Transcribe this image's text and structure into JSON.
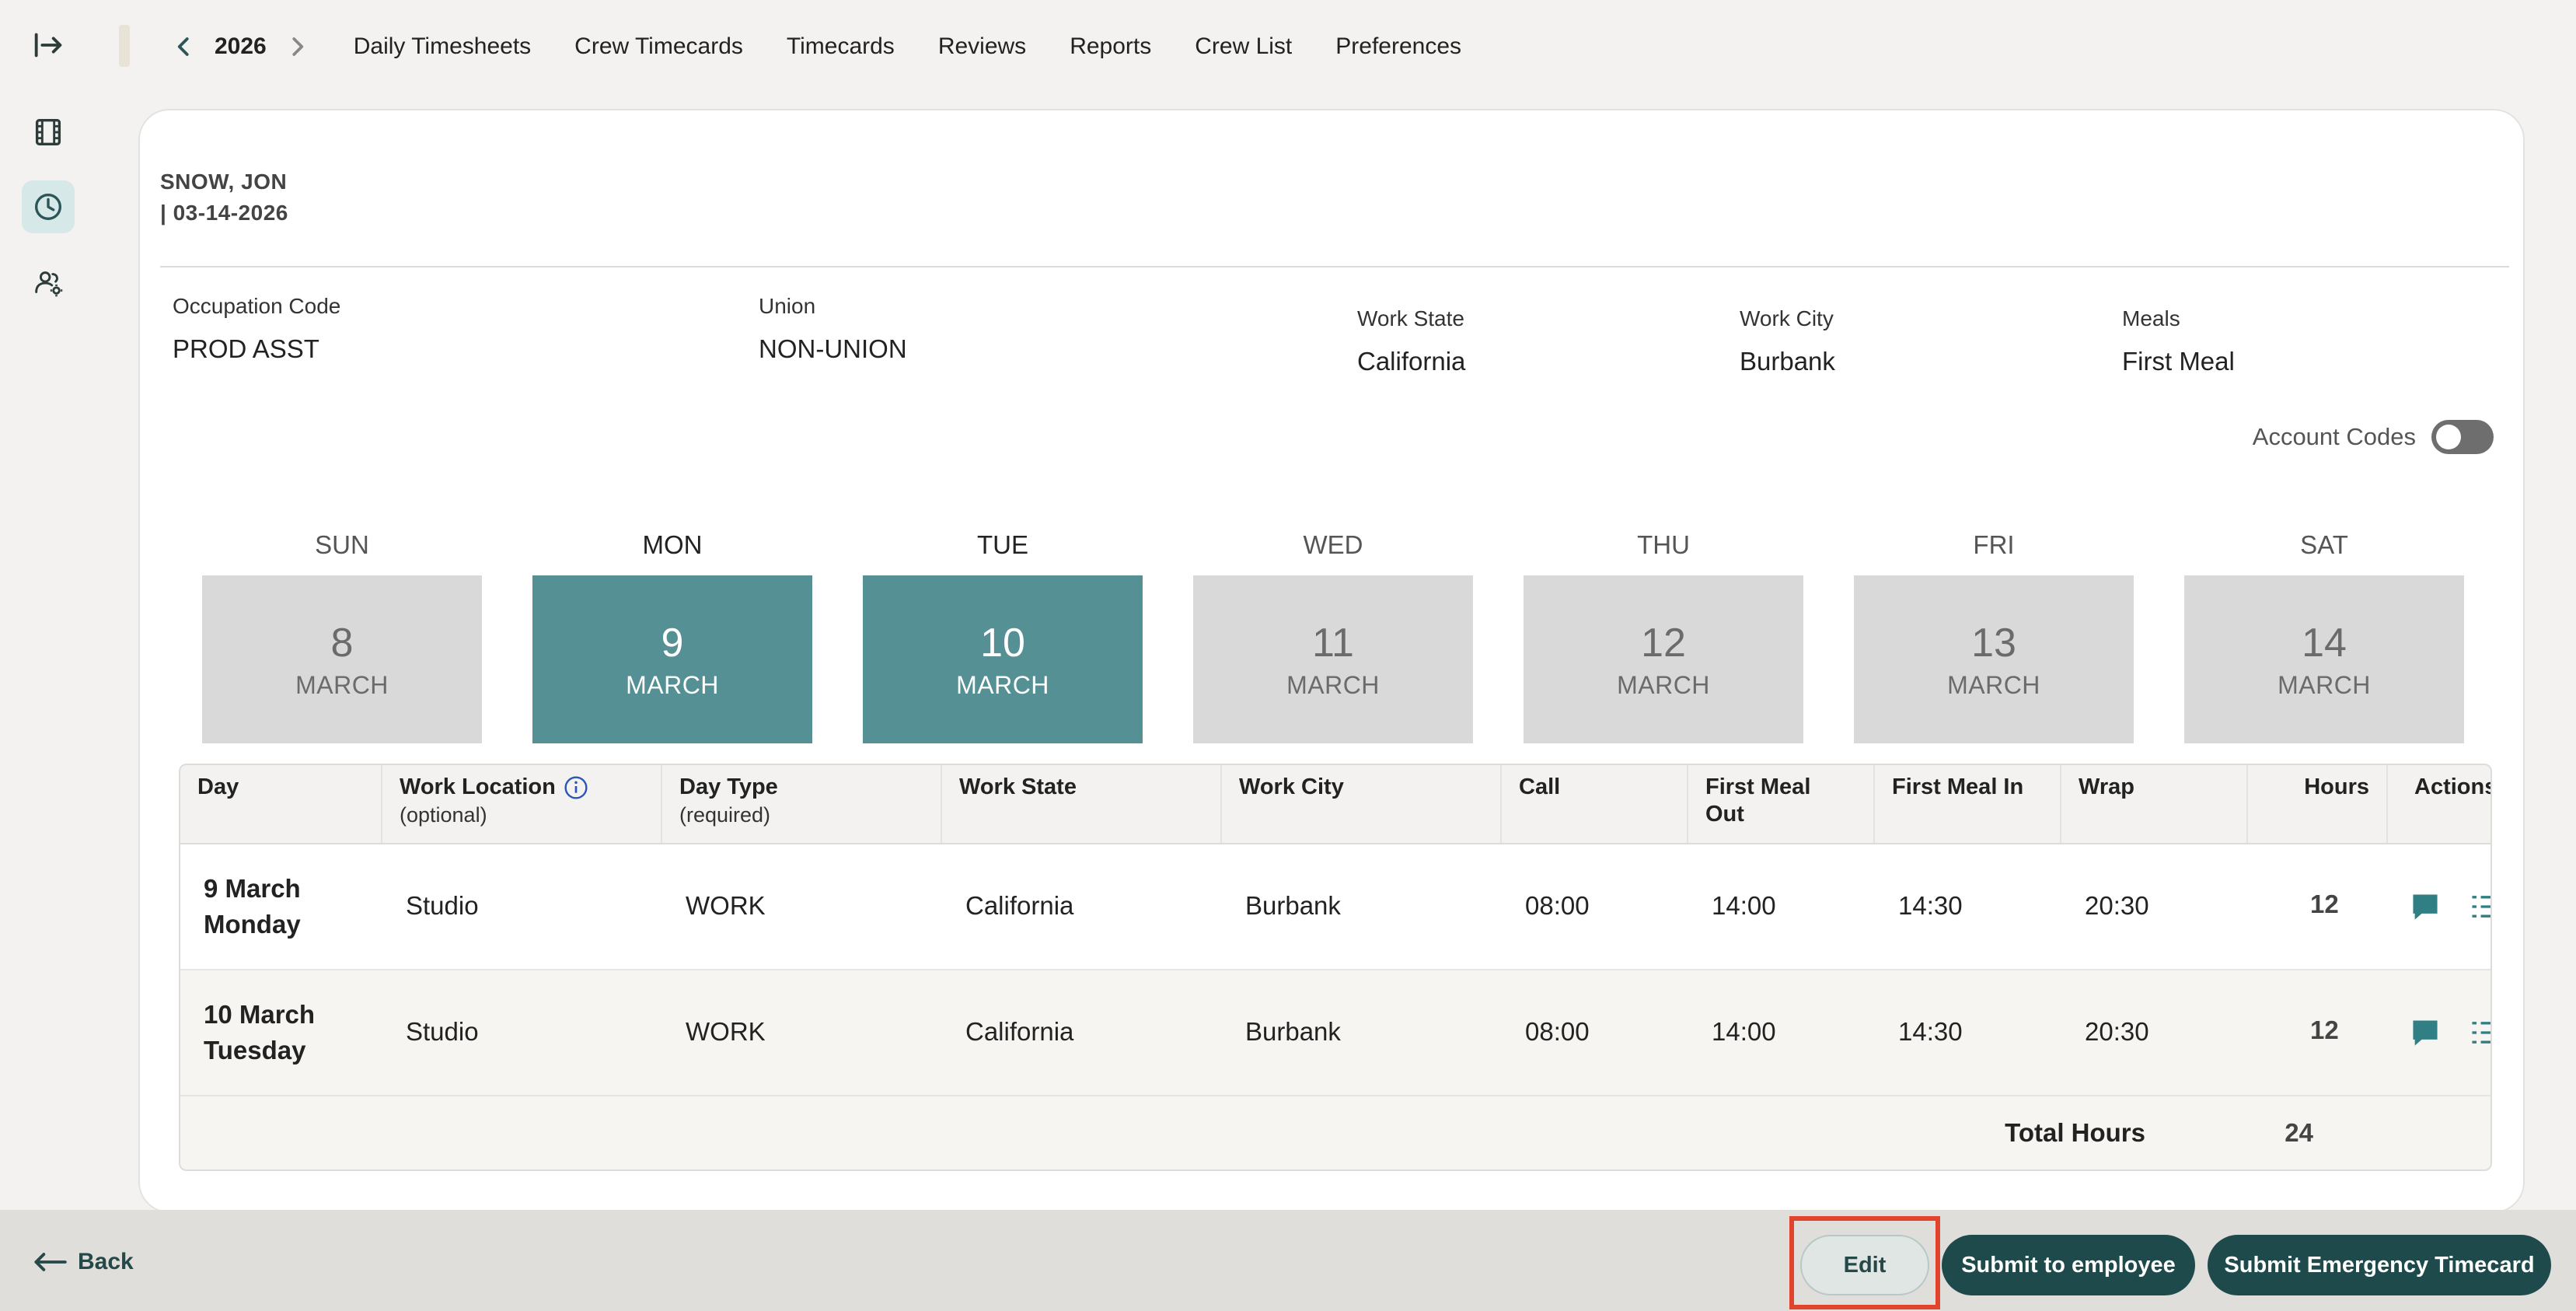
{
  "sidebar": {
    "items": [
      {
        "icon": "collapse-arrow-icon",
        "label": ""
      },
      {
        "icon": "film-icon",
        "label": ""
      },
      {
        "icon": "clock-icon",
        "label": "",
        "active": true
      },
      {
        "icon": "users-settings-icon",
        "label": ""
      }
    ]
  },
  "topnav": {
    "year": "2026",
    "links": [
      "Daily Timesheets",
      "Crew Timecards",
      "Timecards",
      "Reviews",
      "Reports",
      "Crew List",
      "Preferences"
    ]
  },
  "employee": {
    "name": "SNOW, JON",
    "date": "| 03-14-2026"
  },
  "fields": {
    "occupation": {
      "label": "Occupation Code",
      "value": "PROD ASST"
    },
    "union": {
      "label": "Union",
      "value": "NON-UNION"
    },
    "work_state": {
      "label": "Work State",
      "value": "California"
    },
    "work_city": {
      "label": "Work City",
      "value": "Burbank"
    },
    "meals": {
      "label": "Meals",
      "value": "First Meal"
    }
  },
  "account_codes": {
    "label": "Account Codes",
    "enabled": false
  },
  "days": [
    {
      "dow": "SUN",
      "num": "8",
      "month": "MARCH",
      "selected": false
    },
    {
      "dow": "MON",
      "num": "9",
      "month": "MARCH",
      "selected": true
    },
    {
      "dow": "TUE",
      "num": "10",
      "month": "MARCH",
      "selected": true
    },
    {
      "dow": "WED",
      "num": "11",
      "month": "MARCH",
      "selected": false
    },
    {
      "dow": "THU",
      "num": "12",
      "month": "MARCH",
      "selected": false
    },
    {
      "dow": "FRI",
      "num": "13",
      "month": "MARCH",
      "selected": false
    },
    {
      "dow": "SAT",
      "num": "14",
      "month": "MARCH",
      "selected": false
    }
  ],
  "table": {
    "headers": [
      {
        "t1": "Day",
        "t2": ""
      },
      {
        "t1": "Work Location",
        "t2": "(optional)"
      },
      {
        "t1": "Day Type",
        "t2": "(required)"
      },
      {
        "t1": "Work State",
        "t2": ""
      },
      {
        "t1": "Work City",
        "t2": ""
      },
      {
        "t1": "Call",
        "t2": ""
      },
      {
        "t1": "First Meal",
        "t2": "Out"
      },
      {
        "t1": "First Meal In",
        "t2": ""
      },
      {
        "t1": "Wrap",
        "t2": ""
      },
      {
        "t1": "Hours",
        "t2": ""
      },
      {
        "t1": "Actions",
        "t2": ""
      }
    ],
    "rows": [
      {
        "date": "9 March",
        "weekday": "Monday",
        "location": "Studio",
        "day_type": "WORK",
        "state": "California",
        "city": "Burbank",
        "call": "08:00",
        "meal_out": "14:00",
        "meal_in": "14:30",
        "wrap": "20:30",
        "hours": "12"
      },
      {
        "date": "10 March",
        "weekday": "Tuesday",
        "location": "Studio",
        "day_type": "WORK",
        "state": "California",
        "city": "Burbank",
        "call": "08:00",
        "meal_out": "14:00",
        "meal_in": "14:30",
        "wrap": "20:30",
        "hours": "12"
      }
    ],
    "total_label": "Total Hours",
    "total_value": "24"
  },
  "footer": {
    "back_label": "Back",
    "edit_label": "Edit",
    "submit_employee_label": "Submit to employee",
    "submit_emergency_label": "Submit Emergency Timecard"
  },
  "colors": {
    "accent": "#559095",
    "dark_button": "#1f4a4c",
    "highlight": "#e0442c"
  }
}
